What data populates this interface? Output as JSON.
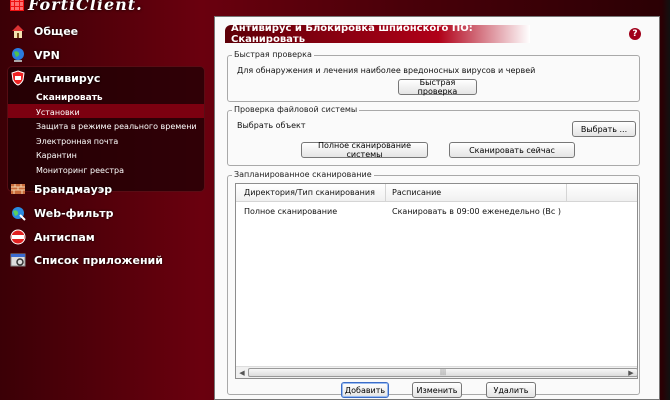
{
  "app": {
    "logo_text": "FortiClient.",
    "brand_color": "#b00018"
  },
  "sidebar": {
    "items": [
      {
        "label": "Общее",
        "icon": "house-icon"
      },
      {
        "label": "VPN",
        "icon": "globe-icon"
      },
      {
        "label": "Антивирус",
        "icon": "shield-icon"
      },
      {
        "label": "Брандмауэр",
        "icon": "firewall-icon"
      },
      {
        "label": "Web-фильтр",
        "icon": "web-filter-icon"
      },
      {
        "label": "Антиспам",
        "icon": "spam-icon"
      },
      {
        "label": "Список приложений",
        "icon": "app-list-icon"
      }
    ],
    "antivirus_sub": [
      "Сканировать",
      "Установки",
      "Защита в режиме реального времени",
      "Электронная почта",
      "Карантин",
      "Мониторинг реестра"
    ]
  },
  "main": {
    "title": "Антивирус и Блокировка шпионского ПО: Сканировать",
    "help": "?",
    "quick_scan": {
      "group_label": "Быстрая проверка",
      "description": "Для обнаружения и лечения наиболее вредоносных вирусов и червей",
      "button": "Быстрая проверка"
    },
    "fs_check": {
      "group_label": "Проверка файловой системы",
      "select_label": "Выбрать объект",
      "browse_button": "Выбрать ...",
      "full_scan_button": "Полное сканирование системы",
      "scan_now_button": "Сканировать сейчас"
    },
    "scheduled": {
      "group_label": "Запланированное сканирование",
      "columns": [
        "Директория/Тип сканирования",
        "Расписание"
      ],
      "rows": [
        [
          "Полное сканирование",
          "Сканировать в 09:00 еженедельно (Вс )"
        ]
      ],
      "add_button": "Добавить",
      "edit_button": "Изменить",
      "delete_button": "Удалить"
    }
  }
}
